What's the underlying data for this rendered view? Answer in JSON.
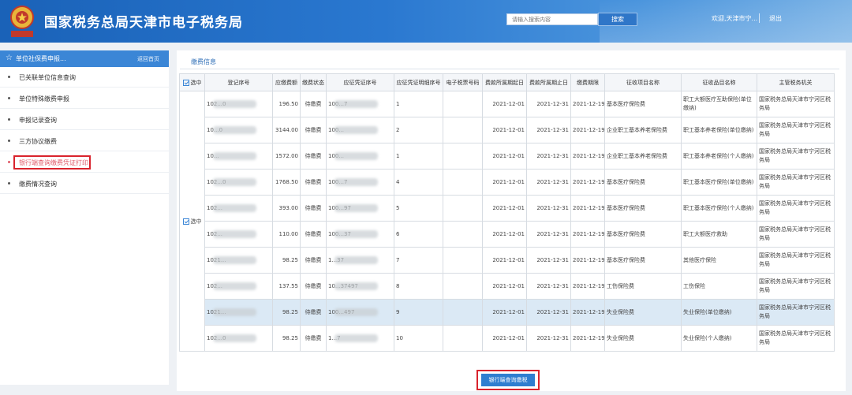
{
  "header": {
    "title": "国家税务总局天津市电子税务局",
    "search_placeholder": "请输入搜索内容",
    "search_button": "搜索",
    "welcome": "欢迎,天津市宁...",
    "logout": "退出",
    "brand_color": "#2a78d0"
  },
  "sidebar": {
    "title": "单位社保费申报...",
    "home_link": "返回首页",
    "items": [
      {
        "label": "已关联单位信息查询"
      },
      {
        "label": "单位特殊缴费申报"
      },
      {
        "label": "申报记录查询"
      },
      {
        "label": "三方协议缴费"
      },
      {
        "label": "银行端查询缴费凭证打印",
        "active": true
      },
      {
        "label": "缴费情况查询"
      }
    ]
  },
  "main": {
    "section_title": "缴费信息",
    "select_all_label": "选中",
    "row_group_label": "选中",
    "columns": [
      "选中",
      "登记序号",
      "应缴费额",
      "缴费状态",
      "应征凭证序号",
      "应征凭证明细序号",
      "电子税票号码",
      "费款所属期起日",
      "费款所属期止日",
      "缴费期限",
      "征收项目名称",
      "征收品目名称",
      "主管税务机关"
    ],
    "rows": [
      {
        "reg": "102...0",
        "amount": "196.50",
        "status": "待缴费",
        "voucher": "100...7",
        "detail": "1",
        "ticket": "",
        "start": "2021-12-01",
        "end": "2021-12-31",
        "deadline": "2021-12-19",
        "item": "基本医疗保险费",
        "subitem": "职工大额医疗互助保险(单位缴纳)",
        "office": "国家税务总局天津市宁河区税务局"
      },
      {
        "reg": "10...0",
        "amount": "3144.00",
        "status": "待缴费",
        "voucher": "100...",
        "detail": "2",
        "ticket": "",
        "start": "2021-12-01",
        "end": "2021-12-31",
        "deadline": "2021-12-19",
        "item": "企业职工基本养老保险费",
        "subitem": "职工基本养老保险(单位缴纳)",
        "office": "国家税务总局天津市宁河区税务局"
      },
      {
        "reg": "10...",
        "amount": "1572.00",
        "status": "待缴费",
        "voucher": "100...",
        "detail": "1",
        "ticket": "",
        "start": "2021-12-01",
        "end": "2021-12-31",
        "deadline": "2021-12-19",
        "item": "企业职工基本养老保险费",
        "subitem": "职工基本养老保险(个人缴纳)",
        "office": "国家税务总局天津市宁河区税务局"
      },
      {
        "reg": "102...0",
        "amount": "1768.50",
        "status": "待缴费",
        "voucher": "100...7",
        "detail": "4",
        "ticket": "",
        "start": "2021-12-01",
        "end": "2021-12-31",
        "deadline": "2021-12-19",
        "item": "基本医疗保险费",
        "subitem": "职工基本医疗保险(单位缴纳)",
        "office": "国家税务总局天津市宁河区税务局"
      },
      {
        "reg": "102...",
        "amount": "393.00",
        "status": "待缴费",
        "voucher": "100...97",
        "detail": "5",
        "ticket": "",
        "start": "2021-12-01",
        "end": "2021-12-31",
        "deadline": "2021-12-19",
        "item": "基本医疗保险费",
        "subitem": "职工基本医疗保险(个人缴纳)",
        "office": "国家税务总局天津市宁河区税务局"
      },
      {
        "reg": "102...",
        "amount": "110.00",
        "status": "待缴费",
        "voucher": "100...37",
        "detail": "6",
        "ticket": "",
        "start": "2021-12-01",
        "end": "2021-12-31",
        "deadline": "2021-12-19",
        "item": "基本医疗保险费",
        "subitem": "职工大额医疗救助",
        "office": "国家税务总局天津市宁河区税务局"
      },
      {
        "reg": "1021...",
        "amount": "98.25",
        "status": "待缴费",
        "voucher": "1...37",
        "detail": "7",
        "ticket": "",
        "start": "2021-12-01",
        "end": "2021-12-31",
        "deadline": "2021-12-19",
        "item": "基本医疗保险费",
        "subitem": "其他医疗保险",
        "office": "国家税务总局天津市宁河区税务局"
      },
      {
        "reg": "102...",
        "amount": "137.55",
        "status": "待缴费",
        "voucher": "10...37497",
        "detail": "8",
        "ticket": "",
        "start": "2021-12-01",
        "end": "2021-12-31",
        "deadline": "2021-12-19",
        "item": "工伤保险费",
        "subitem": "工伤保险",
        "office": "国家税务总局天津市宁河区税务局"
      },
      {
        "reg": "1021...",
        "amount": "98.25",
        "status": "待缴费",
        "voucher": "100...497",
        "detail": "9",
        "ticket": "",
        "start": "2021-12-01",
        "end": "2021-12-31",
        "deadline": "2021-12-19",
        "item": "失业保险费",
        "subitem": "失业保险(单位缴纳)",
        "office": "国家税务总局天津市宁河区税务局",
        "selected": true
      },
      {
        "reg": "102...0",
        "amount": "98.25",
        "status": "待缴费",
        "voucher": "1...7",
        "detail": "10",
        "ticket": "",
        "start": "2021-12-01",
        "end": "2021-12-31",
        "deadline": "2021-12-19",
        "item": "失业保险费",
        "subitem": "失业保险(个人缴纳)",
        "office": "国家税务总局天津市宁河区税务局"
      }
    ],
    "print_button": "银行端查询缴税"
  }
}
